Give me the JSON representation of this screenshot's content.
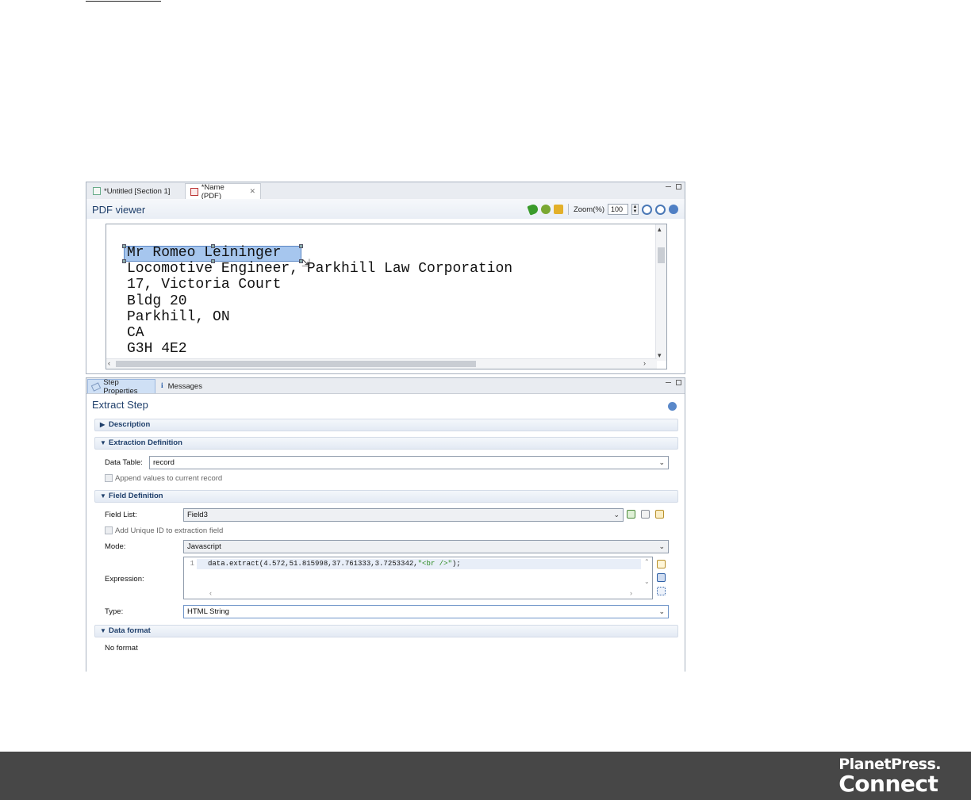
{
  "editor": {
    "tabs": [
      {
        "label": "*Untitled [Section 1]"
      },
      {
        "label": "*Name (PDF)"
      }
    ],
    "viewer_title": "PDF viewer",
    "zoom_label": "Zoom(%)",
    "zoom_value": "100",
    "pdf_lines": [
      "Mr Romeo Leininger",
      "Locomotive Engineer, Parkhill Law Corporation",
      "17, Victoria Court",
      "Bldg 20",
      "Parkhill, ON",
      "CA",
      "G3H 4E2"
    ]
  },
  "properties": {
    "tabs": [
      {
        "label": "Step Properties"
      },
      {
        "label": "Messages"
      }
    ],
    "title": "Extract Step",
    "sections": {
      "description": "Description",
      "extraction_definition": "Extraction Definition",
      "field_definition": "Field Definition",
      "data_format": "Data format"
    },
    "data_table_label": "Data Table:",
    "data_table_value": "record",
    "append_label": "Append values to current record",
    "field_list_label": "Field List:",
    "field_list_value": "Field3",
    "unique_id_label": "Add Unique ID to extraction field",
    "mode_label": "Mode:",
    "mode_value": "Javascript",
    "expression_label": "Expression:",
    "expression_line_no": "1",
    "expression_code": "data.extract(4.572,51.815998,37.761333,3.7253342,",
    "expression_string": "\"<br />\"",
    "expression_tail": ");",
    "type_label": "Type:",
    "type_value": "HTML String",
    "no_format": "No format"
  },
  "footer": {
    "brand_line1": "PlanetPress.",
    "brand_line2": "Connect",
    "background": "#474747"
  }
}
